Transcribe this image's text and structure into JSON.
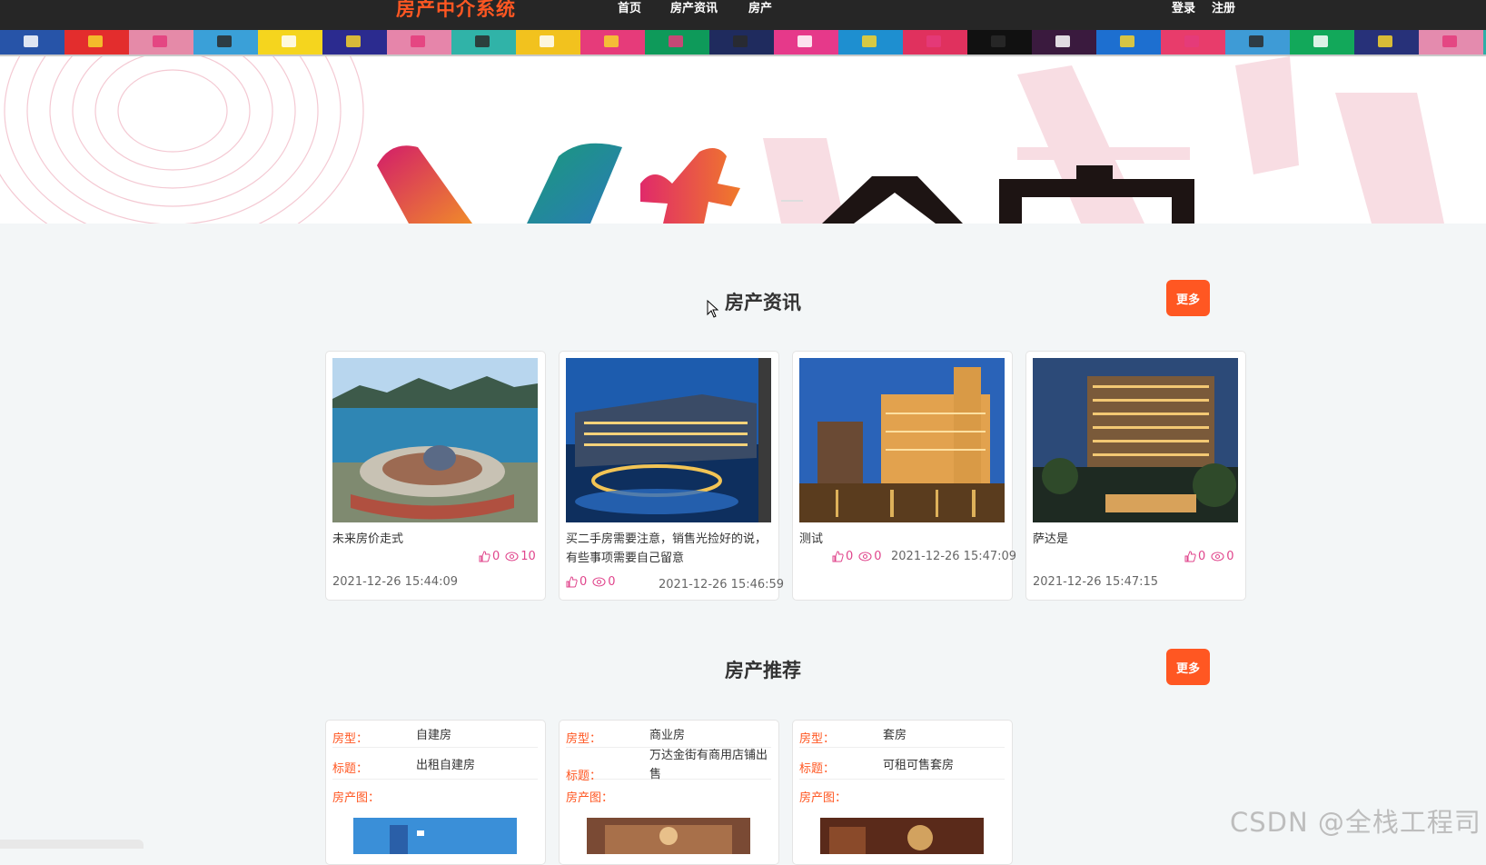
{
  "nav": {
    "brand": "房产中介系统",
    "links": [
      "首页",
      "房产资讯",
      "房产"
    ],
    "login": "登录",
    "register": "注册"
  },
  "strip_colors": [
    "#2754a8",
    "#e32d2d",
    "#e58aa8",
    "#3aa0d8",
    "#f5d51e",
    "#2b2b8f",
    "#e685aa",
    "#30b3a8",
    "#f2c21e",
    "#e63b7a",
    "#0e9a5a",
    "#1f2b5e",
    "#e6398a",
    "#1e8fd0",
    "#e0315e",
    "#111111",
    "#3a1a3e",
    "#1d6fd0",
    "#e83c6b",
    "#3e9bd6",
    "#12a85a",
    "#273179",
    "#e48bae",
    "#2dafa6"
  ],
  "banner": {
    "slides": 2,
    "active": 1
  },
  "news": {
    "title": "房产资讯",
    "more": "更多",
    "items": [
      {
        "title": "未来房价走式",
        "likes": "0",
        "views": "10",
        "date": "2021-12-26 15:44:09",
        "scene": "coast"
      },
      {
        "title": "买二手房需要注意，销售光捡好的说，有些事项需要自己留意",
        "likes": "0",
        "views": "0",
        "date": "2021-12-26 15:46:59",
        "scene": "resort"
      },
      {
        "title": "测试",
        "likes": "0",
        "views": "0",
        "date": "2021-12-26 15:47:09",
        "scene": "casino"
      },
      {
        "title": "萨达是",
        "likes": "0",
        "views": "0",
        "date": "2021-12-26 15:47:15",
        "scene": "hotel"
      }
    ]
  },
  "recommend": {
    "title": "房产推荐",
    "more": "更多",
    "labels": {
      "type": "房型：",
      "title": "标题：",
      "image": "房产图："
    },
    "items": [
      {
        "type": "自建房",
        "title": "出租自建房"
      },
      {
        "type": "商业房",
        "title": "万达金街有商用店铺出售"
      },
      {
        "type": "套房",
        "title": "可租可售套房"
      }
    ]
  },
  "watermark": "CSDN @全栈工程司",
  "colors": {
    "accent": "#ff5722",
    "nav_bg": "#262626",
    "stat": "#e0458c"
  }
}
